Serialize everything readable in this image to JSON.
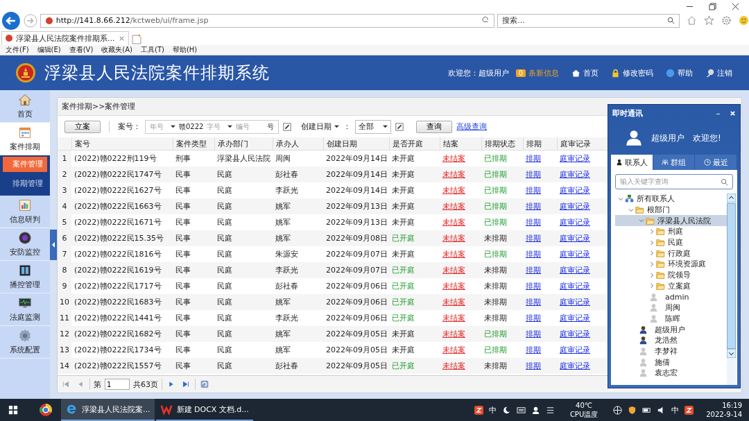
{
  "browser": {
    "url_host": "http://141.8.66.212",
    "url_path": "/kctweb/ui/frame.jsp",
    "search_placeholder": "搜索...",
    "tab_title": "浮梁县人民法院案件排期系...",
    "menu": [
      "文件(F)",
      "编辑(E)",
      "查看(V)",
      "收藏夹(A)",
      "工具(T)",
      "帮助(H)"
    ]
  },
  "header": {
    "title": "浮梁县人民法院案件排期系统",
    "welcome": "欢迎您：超级用户",
    "message_count": "0",
    "message_label": "条新信息",
    "links": [
      "首页",
      "修改密码",
      "帮助",
      "注销"
    ]
  },
  "sidebar": {
    "items": [
      {
        "label": "首页",
        "selected": false
      },
      {
        "label": "案件排期",
        "selected": true,
        "children": [
          {
            "label": "案件管理",
            "selected": true
          },
          {
            "label": "排期管理",
            "selected": false
          }
        ]
      },
      {
        "label": "信息研判",
        "selected": false
      },
      {
        "label": "安防监控",
        "selected": false
      },
      {
        "label": "播控管理",
        "selected": false
      },
      {
        "label": "法庭监测",
        "selected": false
      },
      {
        "label": "系统配置",
        "selected": false
      }
    ]
  },
  "breadcrumb": "案件排期>>案件管理",
  "toolbar": {
    "new_button": "立案",
    "case_label": "案号：",
    "year_placeholder": "年号",
    "prefix": "赣0222",
    "word_placeholder": "字号",
    "number_placeholder": "编号",
    "suffix": "号",
    "date_field": "创建日期",
    "colon": "：",
    "range_value": "全部",
    "query_button": "查询",
    "advanced_link": "高级查询"
  },
  "table": {
    "columns": [
      "案号",
      "案件类型",
      "承办部门",
      "承办人",
      "创建日期",
      "是否开庭",
      "结案",
      "排期状态",
      "排期",
      "庭审记录"
    ],
    "rows": [
      {
        "no": "1",
        "case_no": "(2022)赣0222刑119号",
        "type": "刑事",
        "dept": "浮梁县人民法院",
        "handler": "周闽",
        "date": "2022年09月14日",
        "hearing": "未开庭",
        "hearing_held": false,
        "closure": "未结案",
        "status": "已排期",
        "scheduled": true,
        "schedule": "排期",
        "record": "庭审记录"
      },
      {
        "no": "2",
        "case_no": "(2022)赣0222民1747号",
        "type": "民事",
        "dept": "民庭",
        "handler": "彭社春",
        "date": "2022年09月14日",
        "hearing": "未开庭",
        "hearing_held": false,
        "closure": "未结案",
        "status": "已排期",
        "scheduled": true,
        "schedule": "排期",
        "record": "庭审记录"
      },
      {
        "no": "3",
        "case_no": "(2022)赣0222民1627号",
        "type": "民事",
        "dept": "民庭",
        "handler": "李跃光",
        "date": "2022年09月14日",
        "hearing": "未开庭",
        "hearing_held": false,
        "closure": "未结案",
        "status": "已排期",
        "scheduled": true,
        "schedule": "排期",
        "record": "庭审记录"
      },
      {
        "no": "4",
        "case_no": "(2022)赣0222民1663号",
        "type": "民事",
        "dept": "民庭",
        "handler": "姚军",
        "date": "2022年09月13日",
        "hearing": "未开庭",
        "hearing_held": false,
        "closure": "未结案",
        "status": "已排期",
        "scheduled": true,
        "schedule": "排期",
        "record": "庭审记录"
      },
      {
        "no": "5",
        "case_no": "(2022)赣0222民1671号",
        "type": "民事",
        "dept": "民庭",
        "handler": "姚军",
        "date": "2022年09月13日",
        "hearing": "未开庭",
        "hearing_held": false,
        "closure": "未结案",
        "status": "已排期",
        "scheduled": true,
        "schedule": "排期",
        "record": "庭审记录"
      },
      {
        "no": "6",
        "case_no": "(2022)赣0222民15.35号",
        "type": "民事",
        "dept": "民庭",
        "handler": "姚军",
        "date": "2022年09月08日",
        "hearing": "已开庭",
        "hearing_held": true,
        "closure": "未结案",
        "status": "未排期",
        "scheduled": false,
        "schedule": "排期",
        "record": "庭审记录"
      },
      {
        "no": "7",
        "case_no": "(2022)赣0222民1816号",
        "type": "民事",
        "dept": "民庭",
        "handler": "朱源安",
        "date": "2022年09月07日",
        "hearing": "未开庭",
        "hearing_held": false,
        "closure": "未结案",
        "status": "已排期",
        "scheduled": true,
        "schedule": "排期",
        "record": "庭审记录"
      },
      {
        "no": "8",
        "case_no": "(2022)赣0222民1619号",
        "type": "民事",
        "dept": "民庭",
        "handler": "李跃光",
        "date": "2022年09月07日",
        "hearing": "已开庭",
        "hearing_held": true,
        "closure": "未结案",
        "status": "未排期",
        "scheduled": false,
        "schedule": "排期",
        "record": "庭审记录"
      },
      {
        "no": "9",
        "case_no": "(2022)赣0222民1717号",
        "type": "民事",
        "dept": "民庭",
        "handler": "彭社春",
        "date": "2022年09月06日",
        "hearing": "已开庭",
        "hearing_held": true,
        "closure": "未结案",
        "status": "未排期",
        "scheduled": false,
        "schedule": "排期",
        "record": "庭审记录"
      },
      {
        "no": "10",
        "case_no": "(2022)赣0222民1683号",
        "type": "民事",
        "dept": "民庭",
        "handler": "姚军",
        "date": "2022年09月06日",
        "hearing": "已开庭",
        "hearing_held": true,
        "closure": "未结案",
        "status": "未排期",
        "scheduled": false,
        "schedule": "排期",
        "record": "庭审记录"
      },
      {
        "no": "11",
        "case_no": "(2022)赣0222民1441号",
        "type": "民事",
        "dept": "民庭",
        "handler": "李跃光",
        "date": "2022年09月06日",
        "hearing": "已开庭",
        "hearing_held": true,
        "closure": "未结案",
        "status": "未排期",
        "scheduled": false,
        "schedule": "排期",
        "record": "庭审记录"
      },
      {
        "no": "12",
        "case_no": "(2022)赣0222民1682号",
        "type": "民事",
        "dept": "民庭",
        "handler": "姚军",
        "date": "2022年09月05日",
        "hearing": "未开庭",
        "hearing_held": false,
        "closure": "未结案",
        "status": "已排期",
        "scheduled": true,
        "schedule": "排期",
        "record": "庭审记录"
      },
      {
        "no": "13",
        "case_no": "(2022)赣0222民1734号",
        "type": "民事",
        "dept": "民庭",
        "handler": "姚军",
        "date": "2022年09月05日",
        "hearing": "未开庭",
        "hearing_held": false,
        "closure": "未结案",
        "status": "已排期",
        "scheduled": true,
        "schedule": "排期",
        "record": "庭审记录"
      },
      {
        "no": "14",
        "case_no": "(2022)赣0222民1557号",
        "type": "民事",
        "dept": "民庭",
        "handler": "彭社春",
        "date": "2022年09月05日",
        "hearing": "已开庭",
        "hearing_held": true,
        "closure": "未结案",
        "status": "未排期",
        "scheduled": false,
        "schedule": "排期",
        "record": "庭审记录"
      }
    ]
  },
  "pager": {
    "page_label": "第",
    "page_value": "1",
    "total": "共63页"
  },
  "chat": {
    "title": "即时通讯",
    "user": "超级用户",
    "greeting": "欢迎您!",
    "tabs": [
      {
        "label": "联系人",
        "selected": true
      },
      {
        "label": "群组",
        "selected": false
      },
      {
        "label": "最近",
        "selected": false
      }
    ],
    "search_placeholder": "输入关键字查询",
    "tree": [
      {
        "kind": "group",
        "label": "所有联系人",
        "expanded": true,
        "selected": false,
        "children": [
          {
            "kind": "folder",
            "label": "根部门",
            "expanded": true,
            "selected": false,
            "children": [
              {
                "kind": "folder",
                "label": "浮梁县人民法院",
                "expanded": true,
                "selected": true,
                "children": [
                  {
                    "kind": "folder",
                    "label": "刑庭",
                    "expanded": false,
                    "selected": false
                  },
                  {
                    "kind": "folder",
                    "label": "民庭",
                    "expanded": false,
                    "selected": false
                  },
                  {
                    "kind": "folder",
                    "label": "行政庭",
                    "expanded": false,
                    "selected": false
                  },
                  {
                    "kind": "folder",
                    "label": "环境资源庭",
                    "expanded": false,
                    "selected": false
                  },
                  {
                    "kind": "folder",
                    "label": "院领导",
                    "expanded": false,
                    "selected": false
                  },
                  {
                    "kind": "folder",
                    "label": "立案庭",
                    "expanded": false,
                    "selected": false
                  },
                  {
                    "kind": "user",
                    "label": "admin",
                    "online": false,
                    "selected": false
                  },
                  {
                    "kind": "user",
                    "label": "周闽",
                    "online": false,
                    "selected": false
                  },
                  {
                    "kind": "user",
                    "label": "陈晖",
                    "online": false,
                    "selected": false
                  }
                ]
              },
              {
                "kind": "user",
                "label": "超级用户",
                "online": true,
                "selected": false
              },
              {
                "kind": "user",
                "label": "龙浩然",
                "online": true,
                "selected": false
              },
              {
                "kind": "user",
                "label": "李梦祥",
                "online": false,
                "selected": false
              },
              {
                "kind": "user",
                "label": "施倩",
                "online": false,
                "selected": false
              },
              {
                "kind": "user",
                "label": "袁志宏",
                "online": false,
                "selected": false
              }
            ]
          }
        ]
      }
    ]
  },
  "taskbar": {
    "tasks": [
      {
        "label": "浮梁县人民法院案...",
        "selected": true
      },
      {
        "label": "新建 DOCX 文档.d...",
        "selected": false
      }
    ],
    "ime": "中",
    "temperature": "40℃",
    "temperature_label": "CPU温度",
    "ime2": "中",
    "time": "16:19",
    "date": "2022-9-14"
  }
}
